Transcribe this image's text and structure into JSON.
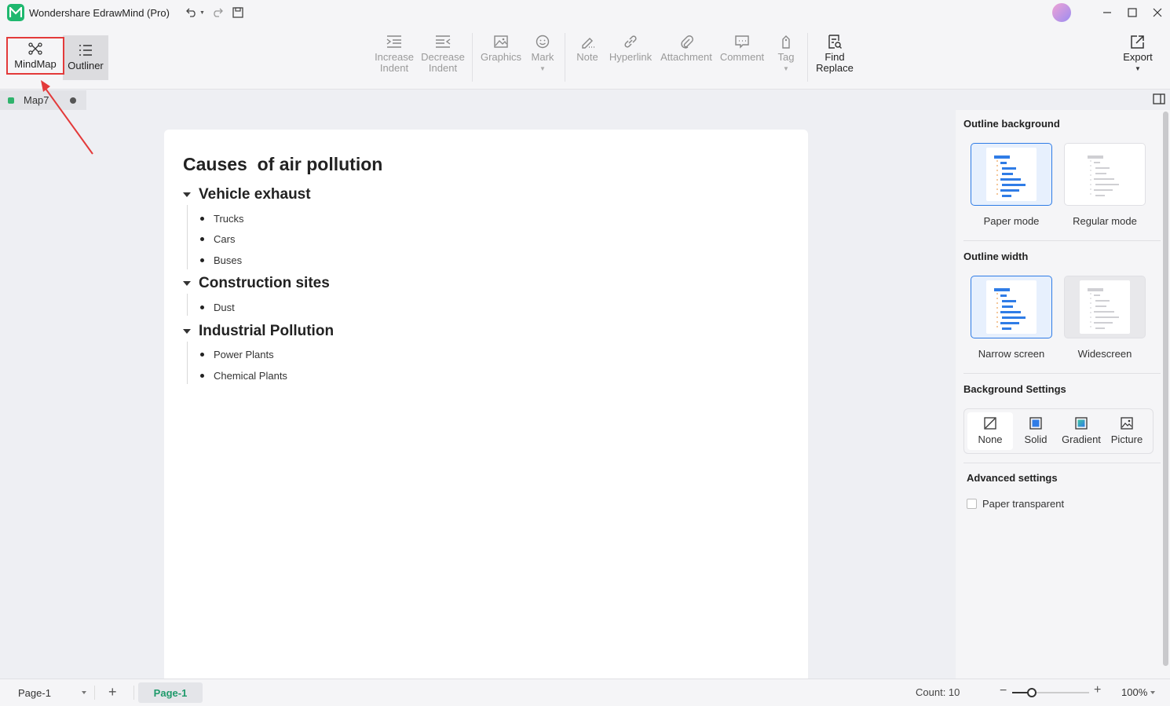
{
  "app": {
    "title": "Wondershare EdrawMind (Pro)"
  },
  "toolbar": {
    "views": {
      "mindmap": "MindMap",
      "outliner": "Outliner"
    },
    "increase_indent": [
      "Increase",
      "Indent"
    ],
    "decrease_indent": [
      "Decrease",
      "Indent"
    ],
    "graphics": "Graphics",
    "mark": "Mark",
    "note": "Note",
    "hyperlink": "Hyperlink",
    "attachment": "Attachment",
    "comment": "Comment",
    "tag": "Tag",
    "find_replace": [
      "Find",
      "Replace"
    ],
    "export": "Export"
  },
  "tab": {
    "name": "Map7"
  },
  "outline": {
    "title": "Causes  of air pollution",
    "sections": [
      {
        "heading": "Vehicle exhaust",
        "items": [
          "Trucks",
          "Cars",
          "Buses"
        ]
      },
      {
        "heading": "Construction sites",
        "items": [
          "Dust"
        ]
      },
      {
        "heading": "Industrial Pollution",
        "items": [
          "Power Plants",
          "Chemical Plants"
        ]
      }
    ]
  },
  "panel": {
    "outline_background": {
      "title": "Outline background",
      "options": [
        "Paper mode",
        "Regular mode"
      ],
      "selected": "Paper mode"
    },
    "outline_width": {
      "title": "Outline width",
      "options": [
        "Narrow screen",
        "Widescreen"
      ],
      "selected": "Narrow screen"
    },
    "background_settings": {
      "title": "Background Settings",
      "options": [
        "None",
        "Solid",
        "Gradient",
        "Picture"
      ],
      "selected": "None"
    },
    "advanced": {
      "title": "Advanced settings",
      "paper_transparent_label": "Paper transparent",
      "paper_transparent": false
    }
  },
  "status": {
    "page_select": "Page-1",
    "page_tab": "Page-1",
    "count": "Count: 10",
    "zoom": "100%",
    "zoom_fraction": 0.25
  },
  "colors": {
    "accent": "#2f7ce6",
    "brand": "#1fb86f",
    "annotation": "#e33a3a",
    "page_tab": "#1f9a6b"
  }
}
